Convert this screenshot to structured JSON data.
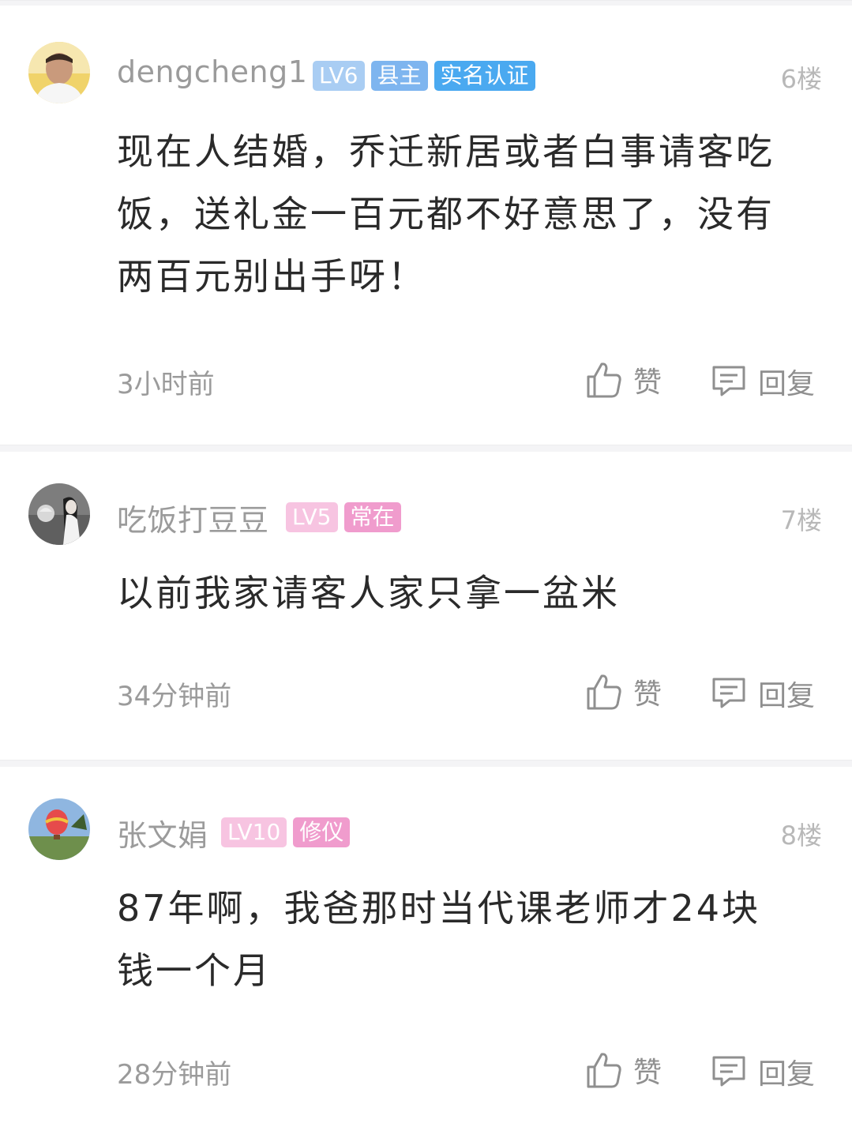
{
  "comments": [
    {
      "username": "dengcheng1",
      "badges": [
        {
          "text": "LV6",
          "color": "#a9cdf3"
        },
        {
          "text": "县主",
          "color": "#7eb5ef"
        },
        {
          "text": "实名认证",
          "color": "#4aa9f0"
        }
      ],
      "floor": "6楼",
      "text": "现在人结婚，乔迁新居或者白事请客吃饭，送礼金一百元都不好意思了，没有两百元别出手呀！",
      "time": "3小时前",
      "like_label": "赞",
      "reply_label": "回复"
    },
    {
      "username": "吃饭打豆豆",
      "badges": [
        {
          "text": "LV5",
          "color": "#f7c4e1"
        },
        {
          "text": "常在",
          "color": "#f09ccd"
        }
      ],
      "floor": "7楼",
      "text": "以前我家请客人家只拿一盆米",
      "time": "34分钟前",
      "like_label": "赞",
      "reply_label": "回复"
    },
    {
      "username": "张文娟",
      "badges": [
        {
          "text": "LV10",
          "color": "#f7c4e1"
        },
        {
          "text": "修仪",
          "color": "#f09ccd"
        }
      ],
      "floor": "8楼",
      "text": "87年啊，我爸那时当代课老师才24块钱一个月",
      "time": "28分钟前",
      "like_label": "赞",
      "reply_label": "回复"
    }
  ],
  "icons": {
    "like": "thumbs-up-icon",
    "reply": "comment-bubble-icon"
  }
}
